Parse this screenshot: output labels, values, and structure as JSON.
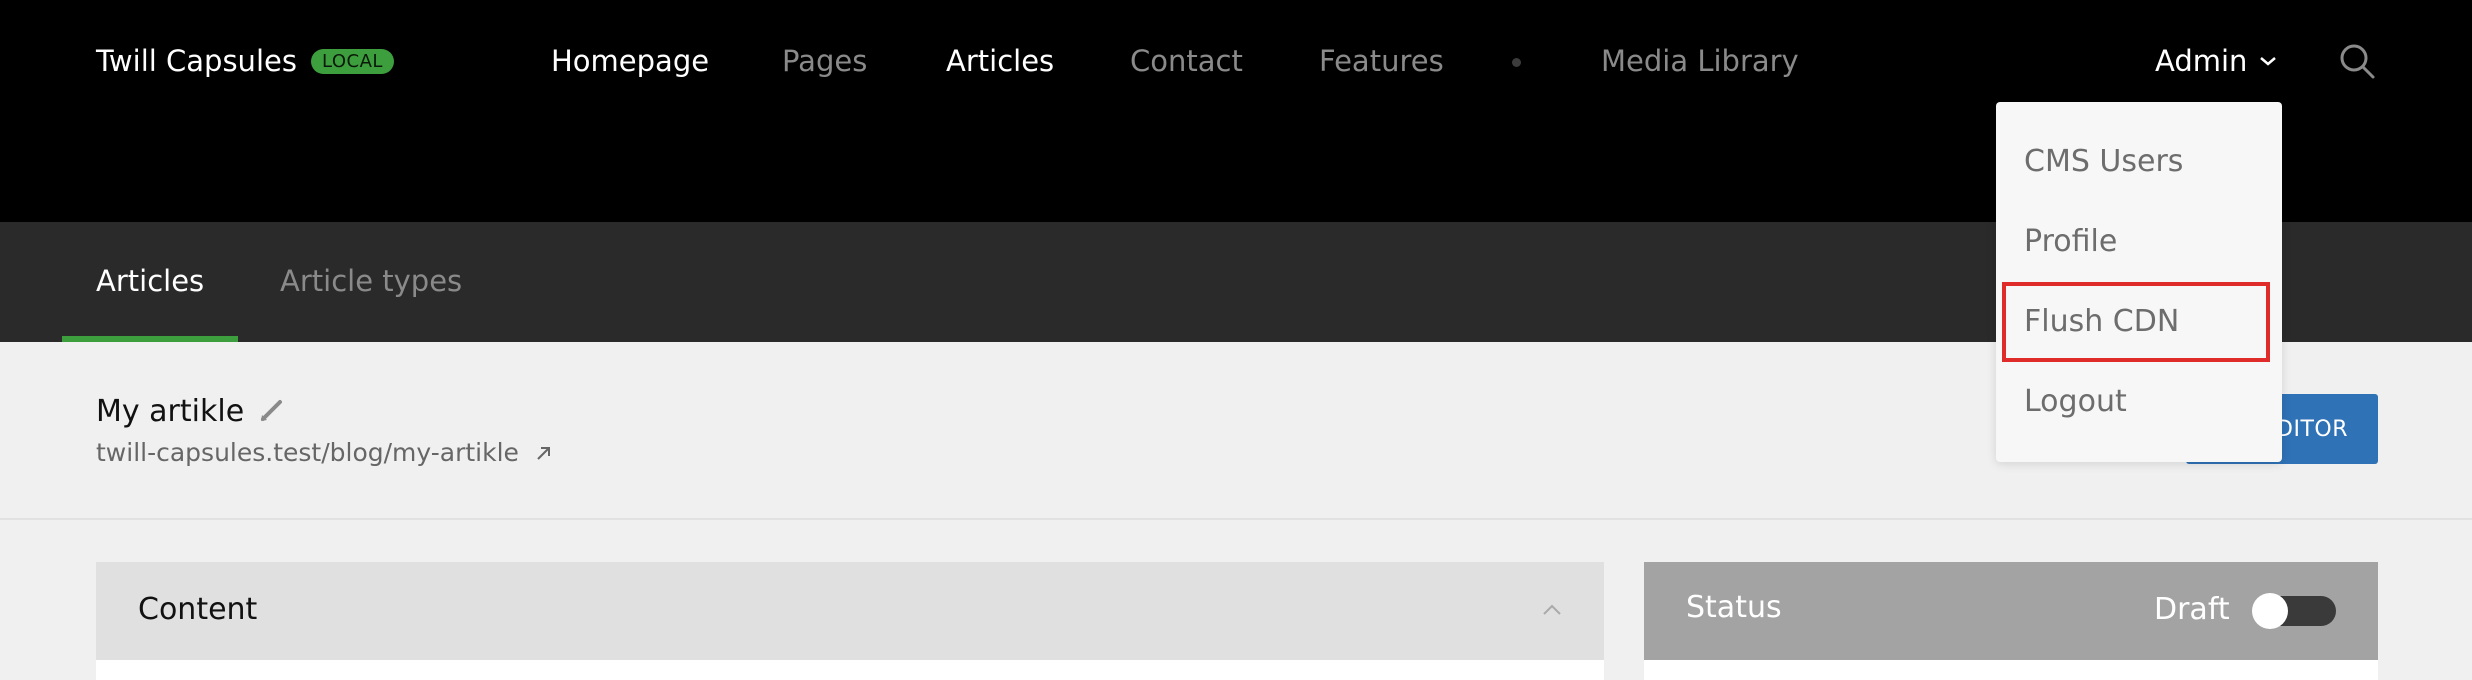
{
  "header": {
    "app_name": "Twill Capsules",
    "env_badge": "LOCAL",
    "nav": [
      {
        "label": "Homepage",
        "active": true
      },
      {
        "label": "Pages",
        "active": false
      },
      {
        "label": "Articles",
        "active": true
      },
      {
        "label": "Contact",
        "active": false
      },
      {
        "label": "Features",
        "active": false
      },
      {
        "label": "Media Library",
        "active": false
      }
    ],
    "user_menu_label": "Admin"
  },
  "user_menu": {
    "items": [
      "CMS Users",
      "Profile",
      "Flush CDN",
      "Logout"
    ],
    "highlighted_item": "Flush CDN"
  },
  "subnav": {
    "tabs": [
      {
        "label": "Articles",
        "active": true
      },
      {
        "label": "Article types",
        "active": false
      }
    ]
  },
  "record": {
    "title": "My artikle",
    "permalink": "twill-capsules.test/blog/my-artikle"
  },
  "editor_button": {
    "label_visible": "DITOR"
  },
  "content_panel": {
    "title": "Content"
  },
  "status_panel": {
    "title": "Status",
    "value": "Draft",
    "published": false
  },
  "colors": {
    "brand_green": "#3d9e3d",
    "primary_blue": "#2f72b6",
    "highlight_red": "#e02b2b"
  }
}
